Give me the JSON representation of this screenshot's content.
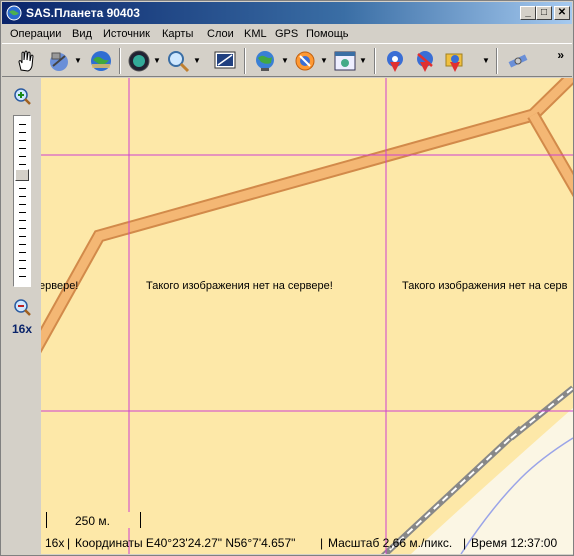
{
  "window": {
    "title": "SAS.Планета 90403",
    "minimize": "_",
    "maximize": "□",
    "close": "✕"
  },
  "menu": {
    "items": [
      "Операции",
      "Вид",
      "Источник",
      "Карты",
      "Слои",
      "KML",
      "GPS",
      "Помощь"
    ]
  },
  "toolbar": {
    "overflow": "»",
    "icons": [
      "hand-icon",
      "satellite-icon",
      "globe-icon",
      "compass-icon",
      "magnifier-icon",
      "screen-icon",
      "world-icon",
      "layers-icon",
      "window-icon",
      "marker-icon",
      "marker-edit-icon",
      "marker-folder-icon",
      "gps-icon"
    ]
  },
  "zoom": {
    "level_label": "16x"
  },
  "map": {
    "no_image_text": "Такого изображения нет на сервере!",
    "no_image_left_clip": "ервере!",
    "no_image_right_clip": "Такого изображения нет на серв",
    "scale_label": "250 м.",
    "colors": {
      "background": "#fde8a8",
      "road_fill": "#f4b774",
      "road_border": "#d28a4a",
      "grid": "#d040d0",
      "railway": "#888888",
      "water": "#9aa4e8"
    }
  },
  "status": {
    "zoom": "16x",
    "coordinates": "Координаты E40°23'24.27\" N56°7'4.657\"",
    "scale": "Масштаб 2,66 м./пикс.",
    "time": "Время 12:37:00"
  }
}
